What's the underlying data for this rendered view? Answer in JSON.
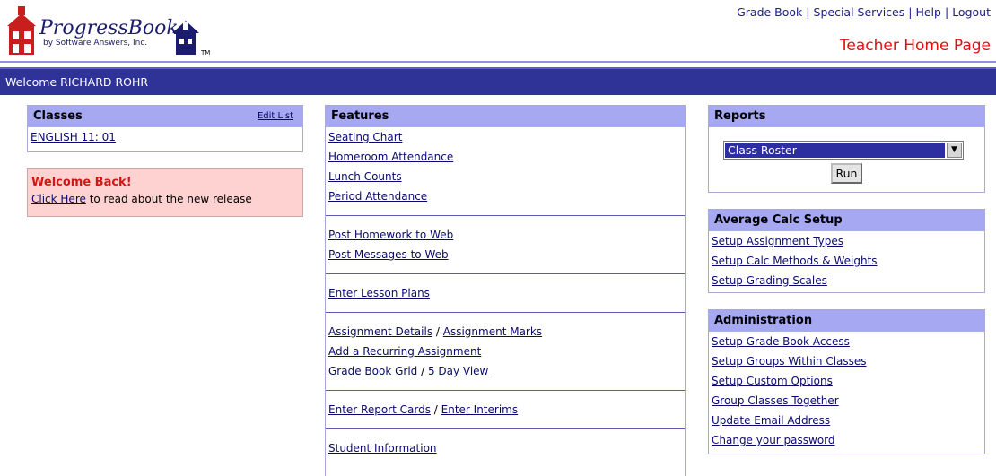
{
  "header": {
    "logo_title": "ProgressBook",
    "logo_sub": "by Software Answers, Inc.",
    "top_links": [
      "Grade Book",
      "Special Services",
      "Help",
      "Logout"
    ],
    "page_heading": "Teacher Home Page",
    "welcome": "Welcome RICHARD ROHR"
  },
  "classes": {
    "title": "Classes",
    "edit_label": "Edit List",
    "items": [
      "ENGLISH 11: 01"
    ]
  },
  "welcome_back": {
    "title": "Welcome Back!",
    "link": "Click Here",
    "text": " to read about the new release"
  },
  "features": {
    "title": "Features",
    "groups": [
      [
        "Seating Chart",
        "Homeroom Attendance",
        "Lunch Counts",
        "Period Attendance"
      ],
      [
        "Post Homework to Web",
        "Post Messages to Web"
      ],
      [
        "Enter Lesson Plans"
      ],
      [
        "Assignment Details",
        "Assignment Marks",
        "Add a Recurring Assignment",
        "Grade Book Grid",
        "5 Day View"
      ],
      [
        "Enter Report Cards",
        "Enter Interims"
      ],
      [
        "Student Information"
      ]
    ]
  },
  "reports": {
    "title": "Reports",
    "selected": "Class Roster",
    "run_label": "Run"
  },
  "avg_calc": {
    "title": "Average Calc Setup",
    "items": [
      "Setup Assignment Types",
      "Setup Calc Methods & Weights",
      "Setup Grading Scales"
    ]
  },
  "administration": {
    "title": "Administration",
    "items": [
      "Setup Grade Book Access",
      "Setup Groups Within Classes",
      "Setup Custom Options",
      "Group Classes Together",
      "Update Email Address",
      "Change your password"
    ]
  },
  "colors": {
    "bar": "#2f3296",
    "panel_head": "#a6a8f2",
    "heading_red": "#e01010"
  }
}
